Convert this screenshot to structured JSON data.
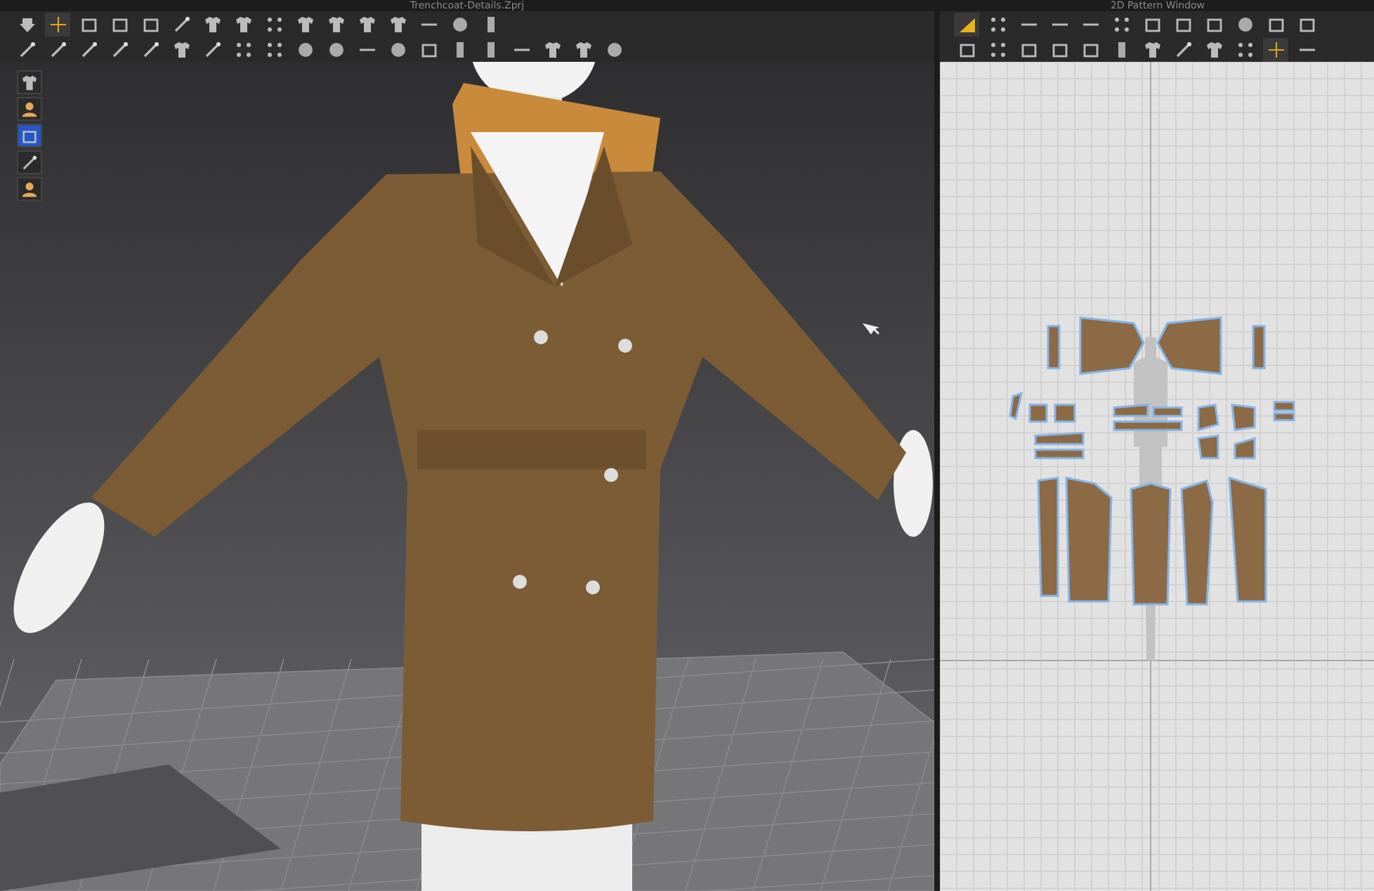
{
  "viewport_window": {
    "title": "Trenchcoat-Details.Zprj",
    "toolbar_rows": [
      [
        {
          "kind": "down",
          "selected": false
        },
        {
          "kind": "move",
          "selected": true
        },
        {
          "kind": "square",
          "selected": false
        },
        {
          "kind": "square",
          "selected": false
        },
        {
          "kind": "square",
          "selected": false
        },
        {
          "kind": "wand",
          "selected": false
        },
        {
          "kind": "shirt",
          "selected": false
        },
        {
          "kind": "shirt",
          "selected": false
        },
        {
          "kind": "dots",
          "selected": false
        },
        {
          "kind": "shirt",
          "selected": false
        },
        {
          "kind": "shirt",
          "selected": false
        },
        {
          "kind": "shirt",
          "selected": false
        },
        {
          "kind": "shirt",
          "selected": false
        },
        {
          "kind": "line",
          "selected": false
        },
        {
          "kind": "circle",
          "selected": false
        },
        {
          "kind": "bar",
          "selected": false
        }
      ],
      [
        {
          "kind": "wand",
          "selected": false
        },
        {
          "kind": "wand",
          "selected": false
        },
        {
          "kind": "wand",
          "selected": false
        },
        {
          "kind": "wand",
          "selected": false
        },
        {
          "kind": "wand",
          "selected": false
        },
        {
          "kind": "shirt",
          "selected": false
        },
        {
          "kind": "wand",
          "selected": false
        },
        {
          "kind": "dots",
          "selected": false
        },
        {
          "kind": "dots",
          "selected": false
        },
        {
          "kind": "circle",
          "selected": false
        },
        {
          "kind": "circle",
          "selected": false
        },
        {
          "kind": "line",
          "selected": false
        },
        {
          "kind": "circle",
          "selected": false
        },
        {
          "kind": "square",
          "selected": false
        },
        {
          "kind": "bar",
          "selected": false
        },
        {
          "kind": "bar",
          "selected": false
        },
        {
          "kind": "line",
          "selected": false
        },
        {
          "kind": "shirt",
          "selected": false
        },
        {
          "kind": "shirt",
          "selected": false
        },
        {
          "kind": "circle",
          "selected": false
        }
      ]
    ],
    "side_tools": [
      {
        "kind": "shirt",
        "selected": false
      },
      {
        "kind": "avatar",
        "selected": false
      },
      {
        "kind": "square",
        "selected": true
      },
      {
        "kind": "wand",
        "selected": false
      },
      {
        "kind": "avatar",
        "selected": false
      }
    ]
  },
  "pattern_window": {
    "title": "2D Pattern Window",
    "toolbar_rows": [
      [
        {
          "kind": "triangle",
          "selected": true
        },
        {
          "kind": "dots",
          "selected": false
        },
        {
          "kind": "line",
          "selected": false
        },
        {
          "kind": "line",
          "selected": false
        },
        {
          "kind": "line",
          "selected": false
        },
        {
          "kind": "dots",
          "selected": false
        },
        {
          "kind": "square",
          "selected": false
        },
        {
          "kind": "square",
          "selected": false
        },
        {
          "kind": "square",
          "selected": false
        },
        {
          "kind": "circle",
          "selected": false
        },
        {
          "kind": "square",
          "selected": false
        },
        {
          "kind": "square",
          "selected": false
        }
      ],
      [
        {
          "kind": "square",
          "selected": false
        },
        {
          "kind": "dots",
          "selected": false
        },
        {
          "kind": "square",
          "selected": false
        },
        {
          "kind": "square",
          "selected": false
        },
        {
          "kind": "square",
          "selected": false
        },
        {
          "kind": "bar",
          "selected": false
        },
        {
          "kind": "shirt",
          "selected": false
        },
        {
          "kind": "wand",
          "selected": false
        },
        {
          "kind": "shirt",
          "selected": false
        },
        {
          "kind": "dots",
          "selected": false
        },
        {
          "kind": "move",
          "selected": true
        },
        {
          "kind": "line",
          "selected": false
        }
      ]
    ]
  }
}
